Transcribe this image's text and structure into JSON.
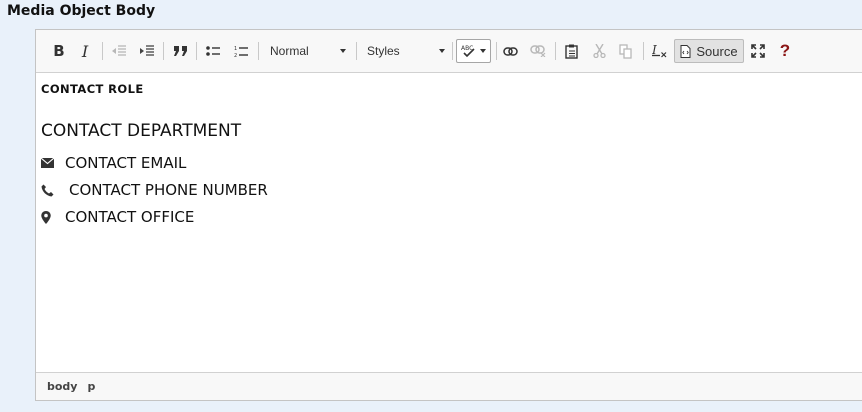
{
  "field_label": "Media Object Body",
  "toolbar": {
    "bold": "B",
    "italic": "I",
    "format_label": "Normal",
    "styles_label": "Styles",
    "source_label": "Source",
    "help_label": "?"
  },
  "content": {
    "role": "CONTACT ROLE",
    "department": "CONTACT DEPARTMENT",
    "email": "CONTACT EMAIL",
    "phone": "CONTACT PHONE NUMBER",
    "office": "CONTACT OFFICE"
  },
  "statusbar": {
    "path": [
      "body",
      "p"
    ]
  },
  "icons": [
    "bold-icon",
    "italic-icon",
    "outdent-icon",
    "indent-icon",
    "blockquote-icon",
    "bulleted-list-icon",
    "numbered-list-icon",
    "spellcheck-icon",
    "link-icon",
    "unlink-icon",
    "paste-icon",
    "cut-icon",
    "copy-icon",
    "remove-format-icon",
    "source-icon",
    "maximize-icon",
    "help-icon",
    "envelope-icon",
    "phone-icon",
    "map-marker-icon"
  ]
}
